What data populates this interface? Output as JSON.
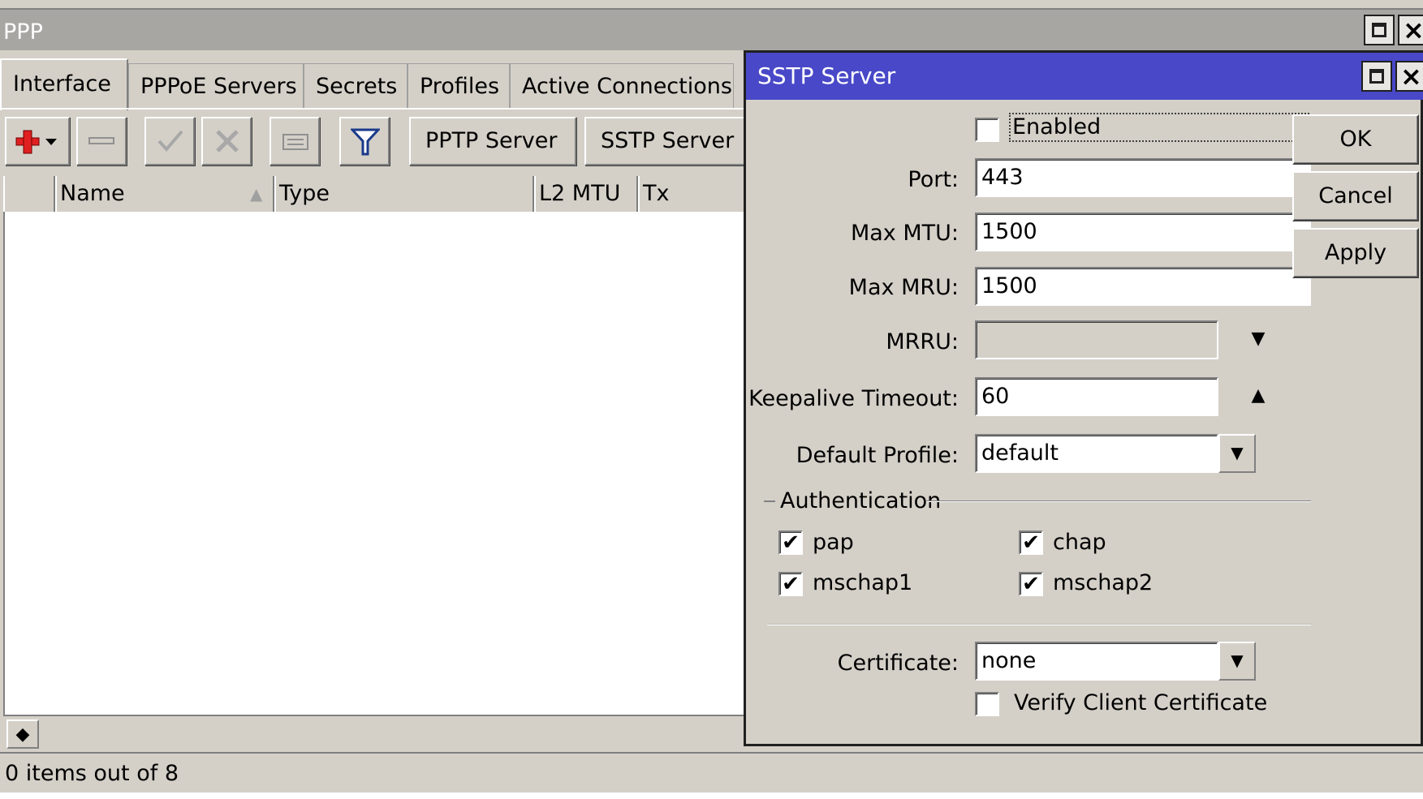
{
  "ppp": {
    "title": "PPP",
    "tabs": [
      "Interface",
      "PPPoE Servers",
      "Secrets",
      "Profiles",
      "Active Connections"
    ],
    "toolbar": {
      "add_icon": "plus-red-icon",
      "remove_icon": "minus-icon",
      "enable_icon": "check-icon",
      "disable_icon": "cross-icon",
      "comment_icon": "comment-icon",
      "filter_icon": "funnel-icon",
      "pptp_label": "PPTP Server",
      "sstp_label": "SSTP Server"
    },
    "columns": [
      "Name",
      "Type",
      "L2 MTU",
      "Tx"
    ],
    "status": "0 items out of 8"
  },
  "sstp": {
    "title": "SSTP Server",
    "enabled_label": "Enabled",
    "enabled": false,
    "fields": {
      "port_label": "Port:",
      "port_value": "443",
      "max_mtu_label": "Max MTU:",
      "max_mtu_value": "1500",
      "max_mru_label": "Max MRU:",
      "max_mru_value": "1500",
      "mrru_label": "MRRU:",
      "mrru_value": "",
      "keepalive_label": "Keepalive Timeout:",
      "keepalive_value": "60",
      "default_profile_label": "Default Profile:",
      "default_profile_value": "default",
      "certificate_label": "Certificate:",
      "certificate_value": "none"
    },
    "auth": {
      "heading": "Authentication",
      "pap": "pap",
      "chap": "chap",
      "mschap1": "mschap1",
      "mschap2": "mschap2",
      "pap_checked": true,
      "chap_checked": true,
      "mschap1_checked": true,
      "mschap2_checked": true
    },
    "verify_label": "Verify Client Certificate",
    "verify_checked": false,
    "buttons": {
      "ok": "OK",
      "cancel": "Cancel",
      "apply": "Apply"
    }
  },
  "colors": {
    "title_active": "#4848c8",
    "title_inactive": "#a8a6a2",
    "face": "#d4d0c8",
    "add_icon": "#e02020"
  }
}
